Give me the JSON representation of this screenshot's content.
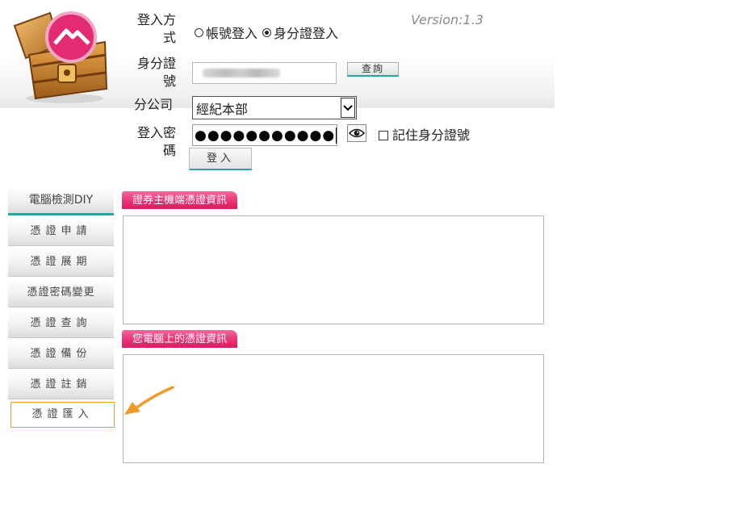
{
  "app": {
    "version": "Version:1.3"
  },
  "login_form": {
    "login_method_label": "登入方式",
    "login_method_options": [
      {
        "label": "帳號登入",
        "selected": false
      },
      {
        "label": "身分證登入",
        "selected": true
      }
    ],
    "id_label": "身分證號",
    "id_value_obscured": true,
    "query_button": "查詢",
    "branch_label": "分公司",
    "branch_selected": "經紀本部",
    "password_label": "登入密碼",
    "password_masked": "●●●●●●●●●●●",
    "show_password_icon": "eye-icon",
    "remember_label": "記住身分證號",
    "remember_checked": false,
    "login_button": "登入"
  },
  "sidebar": {
    "items": [
      {
        "label": "電腦檢測DIY",
        "active": true
      },
      {
        "label": "憑證申請"
      },
      {
        "label": "憑證展期"
      },
      {
        "label": "憑證密碼變更"
      },
      {
        "label": "憑證查詢"
      },
      {
        "label": "憑證備份"
      },
      {
        "label": "憑證註銷"
      },
      {
        "label": "憑證匯入",
        "highlighted": true
      }
    ]
  },
  "panels": {
    "host_cert_title": "證券主機端憑證資訊",
    "pc_cert_title": "您電腦上的憑證資訊"
  },
  "colors": {
    "accent_teal": "#28a79a",
    "tab_pink": "#e6286e",
    "highlight_orange": "#f19a28"
  }
}
